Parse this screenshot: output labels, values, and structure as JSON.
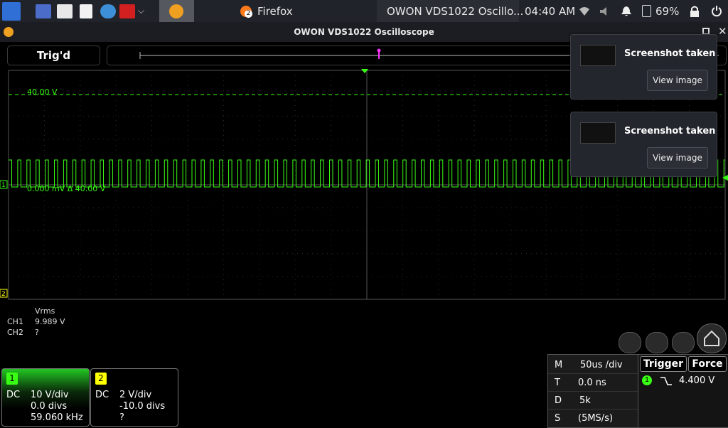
{
  "taskbar": {
    "firefox_label": "Firefox",
    "firefox_badge": "2",
    "active_window": "OWON VDS1022 Oscillo...",
    "clock": "04:40 AM",
    "battery": "69%"
  },
  "window": {
    "title": "OWON VDS1022 Oscilloscope"
  },
  "trigger_status": "Trig'd",
  "scope": {
    "trigger_level_label": "40.00 V",
    "cursor_label": "0.000 mV  Δ 40.00 V",
    "ch1_marker": "1",
    "ch2_marker": "2"
  },
  "measurements": {
    "header": "Vrms",
    "rows": [
      {
        "ch": "CH1",
        "value": "9.989 V"
      },
      {
        "ch": "CH2",
        "value": "?"
      }
    ]
  },
  "channels": [
    {
      "num": "1",
      "coupling": "DC",
      "scale": "10 V/div",
      "offset": "0.0 divs",
      "freq": "59.060 kHz",
      "color": "#39ff14"
    },
    {
      "num": "2",
      "coupling": "DC",
      "scale": "2 V/div",
      "offset": "-10.0 divs",
      "freq": "?",
      "color": "#ffff00"
    }
  ],
  "timebase": [
    {
      "key": "M",
      "value": "50us /div"
    },
    {
      "key": "T",
      "value": "0.0 ns"
    },
    {
      "key": "D",
      "value": "5k"
    },
    {
      "key": "S",
      "value": "(5MS/s)"
    }
  ],
  "trigger": {
    "trigger_label": "Trigger",
    "force_label": "Force",
    "channel": "1",
    "level": "4.400 V"
  },
  "notifications": [
    {
      "title": "Screenshot taken",
      "button": "View image"
    },
    {
      "title": "Screenshot taken",
      "button": "View image"
    }
  ],
  "colors": {
    "ch1": "#39ff14",
    "ch2": "#ffff00",
    "grid": "#3a3a3a"
  }
}
